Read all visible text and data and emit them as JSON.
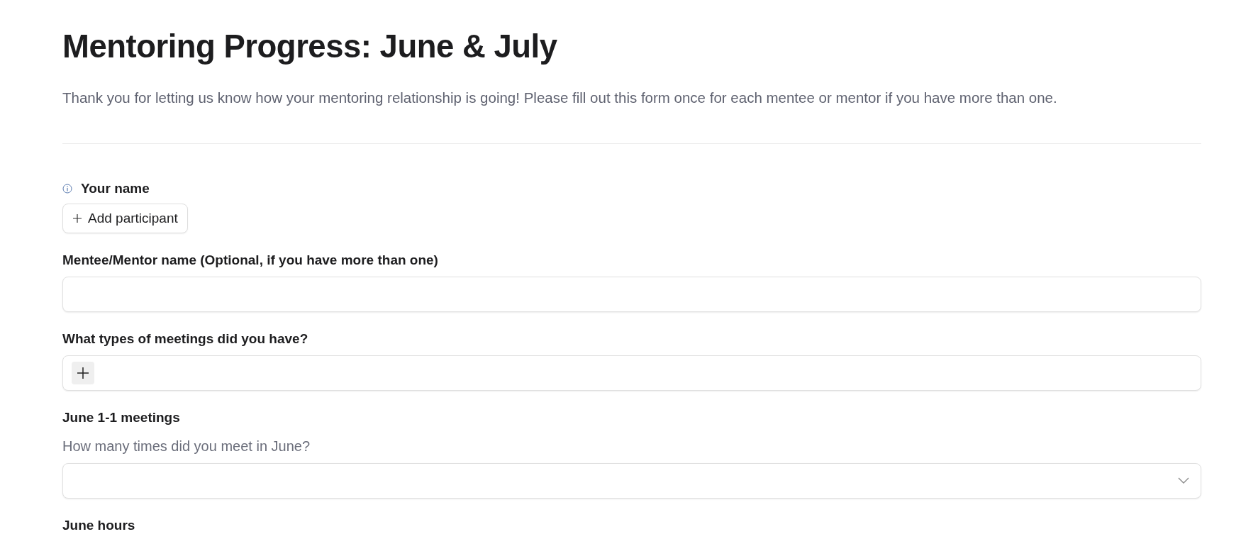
{
  "title": "Mentoring Progress: June & July",
  "description": "Thank you for letting us know how your mentoring relationship is going! Please fill out this form once for each mentee or mentor if you have more than one.",
  "fields": [
    {
      "kind": "participant",
      "label": "Your name",
      "info": true,
      "button": "Add participant"
    },
    {
      "kind": "text",
      "label": "Mentee/Mentor name (Optional, if you have more than one)"
    },
    {
      "kind": "multiselect",
      "label": "What types of meetings did you have?"
    },
    {
      "kind": "select",
      "label": "June 1-1 meetings",
      "description": "How many times did you meet in June?"
    },
    {
      "kind": "heading",
      "label": "June hours"
    }
  ]
}
